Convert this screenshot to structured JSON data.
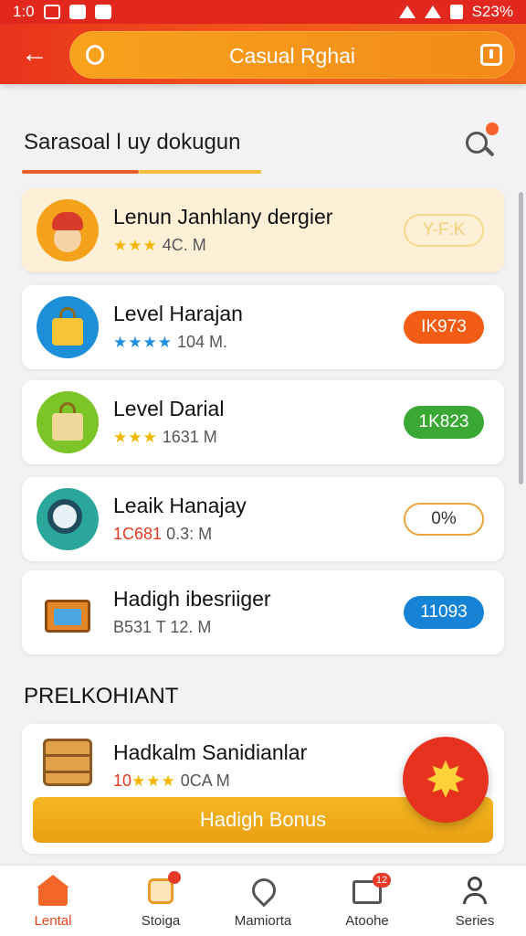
{
  "status_bar": {
    "time": "1:0",
    "battery": "S23%"
  },
  "header": {
    "back_label": "←",
    "title": "Casual Rghai"
  },
  "section": {
    "title": "Sarasoal l uy dokugun"
  },
  "list": [
    {
      "title": "Lenun Janhlany dergier",
      "stars": "★★★",
      "meta": "4C. M",
      "badge": "Y-F:K",
      "badge_style": "ghost",
      "icon": "character-icon"
    },
    {
      "title": "Level Harajan",
      "stars": "★★★★",
      "meta": "104 M.",
      "badge": "IK973",
      "badge_style": "orange",
      "icon": "bag-icon"
    },
    {
      "title": "Level Darial",
      "stars": "★★★",
      "meta": "1631 M",
      "badge": "1K823",
      "badge_style": "green",
      "icon": "bag-icon"
    },
    {
      "title": "Leaik Hanajay",
      "stars": "1C681",
      "meta": "0.3: M",
      "badge": "0%",
      "badge_style": "outline",
      "icon": "magnifier-icon"
    },
    {
      "title": "Hadigh ibesriiger",
      "stars": "B531 T",
      "meta": "12. M",
      "badge": "11093",
      "badge_style": "blue",
      "icon": "treasure-box-icon"
    }
  ],
  "section2": {
    "title": "PRELKOHIANT"
  },
  "bonus": {
    "title": "Hadkalm Sanidianlar",
    "prefix": "10",
    "stars": "★★★",
    "meta": "0CA M",
    "button_label": "Hadigh Bonus"
  },
  "fab": {
    "icon": "✸"
  },
  "bottom_nav": [
    {
      "label": "Lental",
      "icon": "home-icon",
      "active": true
    },
    {
      "label": "Stoiga",
      "icon": "store-icon",
      "active": false
    },
    {
      "label": "Mamiorta",
      "icon": "map-pin-icon",
      "active": false
    },
    {
      "label": "Atoohe",
      "icon": "message-icon",
      "badge": "12",
      "active": false
    },
    {
      "label": "Series",
      "icon": "user-icon",
      "active": false
    }
  ],
  "colors": {
    "primary": "#e8321c",
    "accent": "#f7a21c",
    "green": "#3ba835",
    "blue": "#1783d6"
  }
}
